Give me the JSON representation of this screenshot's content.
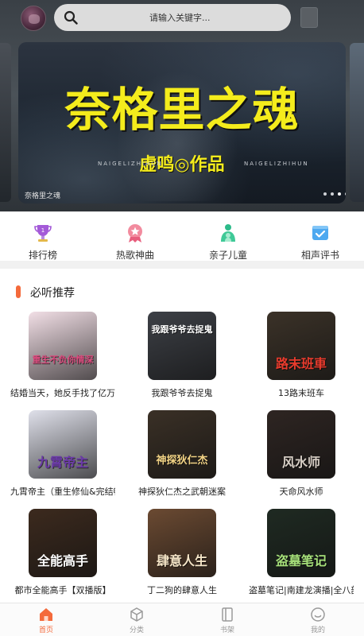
{
  "search": {
    "placeholder": "请输入关键字..."
  },
  "banner": {
    "title": "奈格里之魂",
    "pinyin_left": "NAIGELIZHIHUN",
    "pinyin_right": "NAIGELIZHIHUN",
    "author": "虚鸣◎作品",
    "caption": "奈格里之魂"
  },
  "quicknav": [
    {
      "label": "排行榜",
      "icon": "trophy-icon"
    },
    {
      "label": "热歌神曲",
      "icon": "star-icon"
    },
    {
      "label": "亲子儿童",
      "icon": "family-icon"
    },
    {
      "label": "相声评书",
      "icon": "book-check-icon"
    }
  ],
  "section": {
    "title": "必听推荐"
  },
  "books": [
    {
      "title": "结婚当天，她反手找了亿万...",
      "cover_text": "重生不负你情深",
      "cover_bg": "#f2dfe6",
      "cover_color": "#d94b7d"
    },
    {
      "title": "我跟爷爷去捉鬼",
      "cover_text": "我跟爷爷去捉鬼",
      "cover_bg": "#3d4046",
      "cover_color": "#ffffff"
    },
    {
      "title": "13路末班车",
      "cover_text": "路末班車",
      "cover_bg": "#3b3228",
      "cover_color": "#e83b2d"
    },
    {
      "title": "九霄帝主（重生修仙&完结畅...",
      "cover_text": "九霄帝主",
      "cover_bg": "#dfe0ea",
      "cover_color": "#6b3aa8"
    },
    {
      "title": "神探狄仁杰之武朝迷案",
      "cover_text": "神探狄仁杰",
      "cover_bg": "#3a3026",
      "cover_color": "#f3d486"
    },
    {
      "title": "天命风水师",
      "cover_text": "风水师",
      "cover_bg": "#2e2522",
      "cover_color": "#d8cfc6"
    },
    {
      "title": "都市全能高手【双播版】",
      "cover_text": "全能高手",
      "cover_bg": "#3c2a1e",
      "cover_color": "#ffffff"
    },
    {
      "title": "丁二狗的肆意人生",
      "cover_text": "肆意人生",
      "cover_bg": "#6b4a32",
      "cover_color": "#f6e6c8"
    },
    {
      "title": "盗墓笔记|南建龙演播|全八部...",
      "cover_text": "盗墓笔记",
      "cover_bg": "#1f2a22",
      "cover_color": "#a6e07a"
    }
  ],
  "tabs": [
    {
      "label": "首页",
      "icon": "home-icon",
      "active": true
    },
    {
      "label": "分类",
      "icon": "category-icon",
      "active": false
    },
    {
      "label": "书架",
      "icon": "bookshelf-icon",
      "active": false
    },
    {
      "label": "我的",
      "icon": "profile-icon",
      "active": false
    }
  ],
  "colors": {
    "accent": "#f46a3b",
    "banner_title": "#f4ec1c"
  }
}
